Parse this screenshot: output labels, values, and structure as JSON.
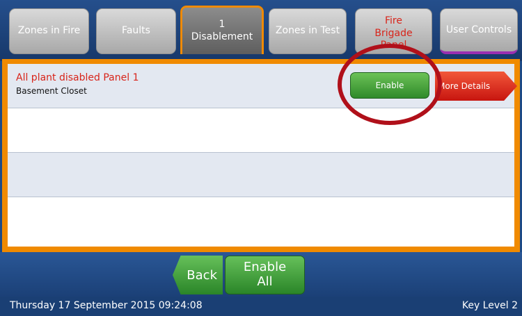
{
  "tabs": [
    {
      "label": "Zones in Fire"
    },
    {
      "label": "Faults"
    },
    {
      "count": "1",
      "label": "Disablement"
    },
    {
      "label": "Zones in Test"
    },
    {
      "label": "Fire Brigade Panel"
    },
    {
      "label": "User Controls"
    }
  ],
  "rows": [
    {
      "title": "All plant disabled Panel 1",
      "subtitle": "Basement Closet",
      "enable_label": "Enable",
      "details_label": "More Details"
    }
  ],
  "footer": {
    "back_label": "Back",
    "enable_all_label": "Enable All"
  },
  "status": {
    "datetime": "Thursday 17 September 2015 09:24:08",
    "access_level": "Key Level 2"
  },
  "colors": {
    "accent": "#f08a00",
    "alarm_text": "#d8241a",
    "action_green": "#3a9a34",
    "highlight_circle": "#b0101a"
  }
}
